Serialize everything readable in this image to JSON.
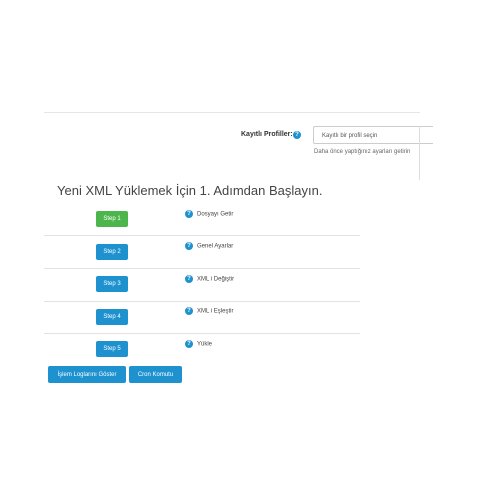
{
  "profile": {
    "label": "Kayıtlı Profiller:",
    "help_icon": "?",
    "select_value": "Kayıtlı bir profil seçin",
    "hint": "Daha önce yaptığınız ayarları getirin"
  },
  "heading": "Yeni XML Yüklemek İçin 1. Adımdan Başlayın.",
  "steps": [
    {
      "button": "Step 1",
      "help_icon": "?",
      "description": "Dosyayı Getir"
    },
    {
      "button": "Step 2",
      "help_icon": "?",
      "description": "Genel Ayarlar"
    },
    {
      "button": "Step 3",
      "help_icon": "?",
      "description": "XML i Değiştir"
    },
    {
      "button": "Step 4",
      "help_icon": "?",
      "description": "XML i Eşleştir"
    },
    {
      "button": "Step 5",
      "help_icon": "?",
      "description": "Yükle"
    }
  ],
  "actions": {
    "logs_button": "İşlem Loglarını Göster",
    "cron_button": "Cron Komutu"
  },
  "colors": {
    "primary": "#1e91cf",
    "active_step": "#4cb64c"
  }
}
